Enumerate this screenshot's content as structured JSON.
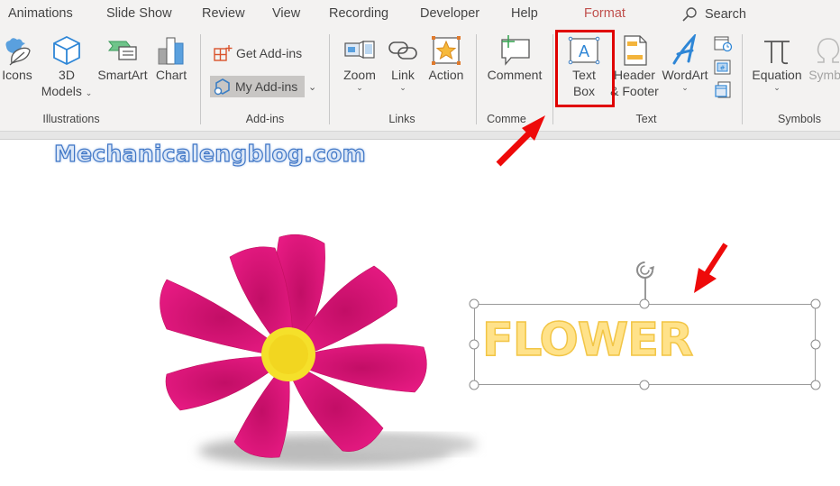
{
  "tabs": [
    {
      "label": "Animations",
      "active": false
    },
    {
      "label": "Slide Show",
      "active": false
    },
    {
      "label": "Review",
      "active": false
    },
    {
      "label": "View",
      "active": false
    },
    {
      "label": "Recording",
      "active": false
    },
    {
      "label": "Developer",
      "active": false
    },
    {
      "label": "Help",
      "active": false
    },
    {
      "label": "Format",
      "active": true
    }
  ],
  "search": {
    "label": "Search",
    "icon": "search-icon"
  },
  "ribbon": {
    "illustrations": {
      "label": "Illustrations",
      "icons": "Icons",
      "models_line1": "3D",
      "models_line2": "Models",
      "smartart": "SmartArt",
      "chart": "Chart"
    },
    "addins": {
      "label": "Add-ins",
      "get": "Get Add-ins",
      "my": "My Add-ins"
    },
    "links": {
      "label": "Links",
      "zoom": "Zoom",
      "link": "Link",
      "action": "Action"
    },
    "comments": {
      "label": "Comme",
      "comment": "Comment"
    },
    "text": {
      "label": "Text",
      "textbox_line1": "Text",
      "textbox_line2": "Box",
      "header_line1": "Header",
      "header_line2": "& Footer",
      "wordart": "WordArt"
    },
    "symbols": {
      "label": "Symbols",
      "equation": "Equation",
      "symbol": "Symbo"
    }
  },
  "slide": {
    "watermark": "Mechanicalengblog.com",
    "textbox_text": "FLOWER"
  },
  "colors": {
    "active_tab": "#c0504d",
    "highlight_box": "#e00000",
    "flower_petal": "#e0147a",
    "flower_center": "#f5e02a",
    "wordart_fill": "#ffe28a",
    "accent_blue": "#2e75c9"
  }
}
